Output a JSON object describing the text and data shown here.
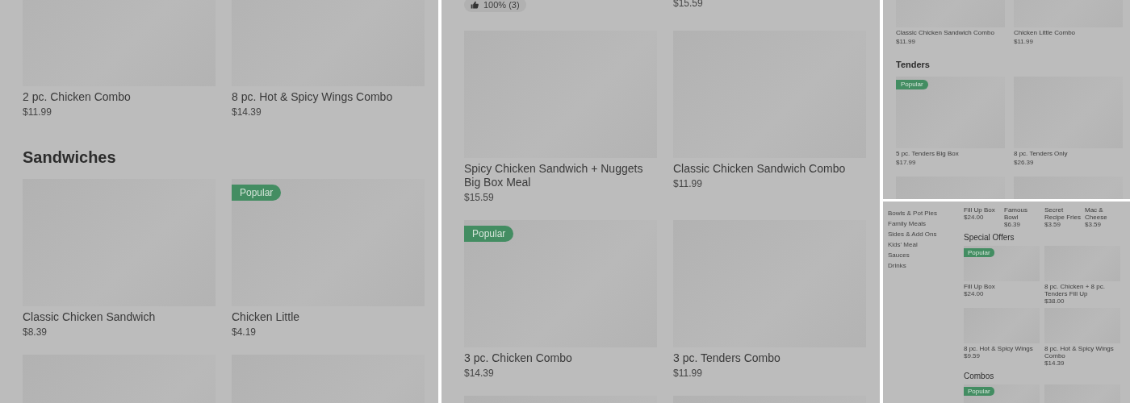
{
  "panels": [
    {
      "kind": "large",
      "sections": [
        {
          "items": [
            {
              "kind": "card",
              "name": "2 pc. Chicken Combo",
              "price": "$11.99"
            },
            {
              "kind": "card",
              "name": "8 pc. Hot & Spicy Wings Combo",
              "price": "$14.39"
            }
          ]
        },
        {
          "heading": "Sandwiches",
          "items": [
            {
              "kind": "card",
              "name": "Classic Chicken Sandwich",
              "price": "$8.39"
            },
            {
              "kind": "card",
              "name": "Chicken Little",
              "price": "$4.19",
              "badge": "Popular"
            },
            {
              "kind": "card"
            },
            {
              "kind": "card"
            }
          ]
        }
      ]
    },
    {
      "kind": "large",
      "sections": [
        {
          "items": [
            {
              "kind": "text",
              "rating": "100% (3)"
            },
            {
              "kind": "text",
              "price": "$15.59"
            }
          ]
        },
        {
          "items": [
            {
              "kind": "card",
              "name": "Spicy Chicken Sandwich + Nuggets Big Box Meal",
              "price": "$15.59"
            },
            {
              "kind": "card",
              "name": "Classic Chicken Sandwich Combo",
              "price": "$11.99"
            },
            {
              "kind": "card",
              "name": "3 pc. Chicken Combo",
              "price": "$14.39",
              "badge": "Popular"
            },
            {
              "kind": "card",
              "name": "3 pc. Tenders Combo",
              "price": "$11.99"
            },
            {
              "kind": "card"
            },
            {
              "kind": "card"
            }
          ]
        }
      ]
    },
    {
      "kind": "medium",
      "sections": [
        {
          "items": [
            {
              "kind": "card",
              "name": "Classic Chicken Sandwich Combo",
              "price": "$11.99"
            },
            {
              "kind": "card",
              "name": "Chicken Little Combo",
              "price": "$11.99"
            }
          ]
        },
        {
          "heading": "Tenders",
          "items": [
            {
              "kind": "card",
              "name": "5 pc. Tenders Big Box",
              "price": "$17.99",
              "badge": "Popular"
            },
            {
              "kind": "card",
              "name": "8 pc. Tenders Only",
              "price": "$26.39"
            },
            {
              "kind": "card"
            },
            {
              "kind": "card"
            }
          ]
        }
      ]
    },
    {
      "kind": "small",
      "sidebar": [
        "Bowls & Pot Pies",
        "Family Meals",
        "Sides & Add Ons",
        "Kids' Meal",
        "Sauces",
        "Drinks"
      ],
      "sections": [
        {
          "items": [
            {
              "kind": "text",
              "name": "Fill Up Box",
              "price": "$24.00"
            },
            {
              "kind": "text",
              "name": "Famous Bowl",
              "price": "$6.39"
            },
            {
              "kind": "text",
              "name": "Secret Recipe Fries",
              "price": "$3.59"
            },
            {
              "kind": "text",
              "name": "Mac & Cheese",
              "price": "$3.59"
            }
          ]
        },
        {
          "heading": "Special Offers",
          "items": [
            {
              "kind": "card",
              "name": "Fill Up Box",
              "price": "$24.00",
              "badge": "Popular"
            },
            {
              "kind": "card",
              "name": "8 pc. Chicken + 8 pc. Tenders Fill Up",
              "price": "$38.00"
            },
            {
              "kind": "card",
              "name": "8 pc. Hot & Spicy Wings",
              "price": "$9.59"
            },
            {
              "kind": "card",
              "name": "8 pc. Hot & Spicy Wings Combo",
              "price": "$14.39"
            }
          ]
        },
        {
          "heading": "Combos",
          "items": [
            {
              "kind": "card",
              "badge": "Popular"
            },
            {
              "kind": "card"
            }
          ]
        }
      ]
    }
  ]
}
